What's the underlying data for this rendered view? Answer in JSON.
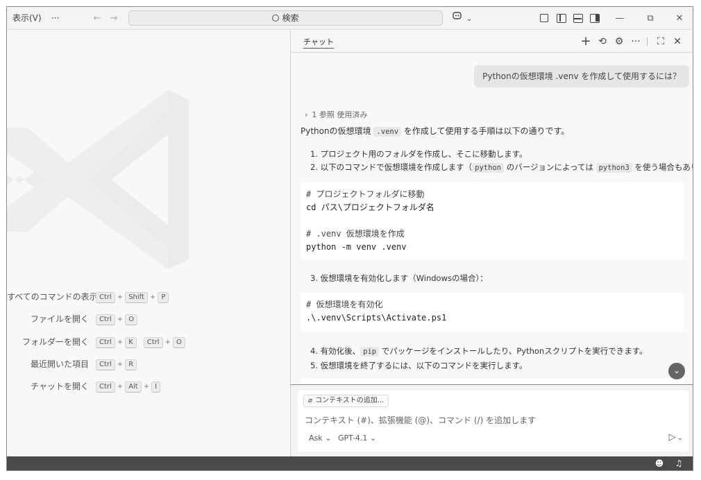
{
  "titlebar": {
    "menu_view": "表示(V)",
    "more": "···",
    "back": "←",
    "forward": "→",
    "search_placeholder": "検索",
    "copilot_chevron": "⌄",
    "minimize": "—",
    "maximize": "⧉",
    "close": "✕"
  },
  "shortcuts": [
    {
      "label": "すべてのコマンドの表示",
      "keys": [
        [
          "Ctrl",
          "Shift",
          "P"
        ]
      ]
    },
    {
      "label": "ファイルを開く",
      "keys": [
        [
          "Ctrl",
          "O"
        ]
      ]
    },
    {
      "label": "フォルダーを開く",
      "keys": [
        [
          "Ctrl",
          "K"
        ],
        [
          "Ctrl",
          "O"
        ]
      ]
    },
    {
      "label": "最近開いた項目",
      "keys": [
        [
          "Ctrl",
          "R"
        ]
      ]
    },
    {
      "label": "チャットを開く",
      "keys": [
        [
          "Ctrl",
          "Alt",
          "I"
        ]
      ]
    }
  ],
  "chat": {
    "tab_label": "チャット",
    "user_message": "Pythonの仮想環境 .venv を作成して使用するには？",
    "refs": "1 参照 使用済み",
    "intro": {
      "a": "Pythonの仮想環境 ",
      "code": ".venv",
      "b": " を作成して使用する手順は以下の通りです。"
    },
    "step1": "1. プロジェクト用のフォルダを作成し、そこに移動します。",
    "step2": {
      "a": "2. 以下のコマンドで仮想環境を作成します（",
      "code1": "python",
      "b": " のバージョンによっては ",
      "code2": "python3",
      "c": " を使う場合もあります）。"
    },
    "code1": [
      "# プロジェクトフォルダに移動",
      "cd パス\\プロジェクトフォルダ名",
      "",
      "# .venv 仮想環境を作成",
      "python -m venv .venv"
    ],
    "step3": "3. 仮想環境を有効化します（Windowsの場合）：",
    "code2": [
      "# 仮想環境を有効化",
      ".\\.venv\\Scripts\\Activate.ps1"
    ],
    "step4": {
      "a": "4. 有効化後、",
      "code": "pip",
      "b": " でパッケージをインストールしたり、Pythonスクリプトを実行できます。"
    },
    "step5": "5. 仮想環境を終了するには、以下のコマンドを実行します。",
    "context_button": "コンテキストの追加...",
    "input_placeholder": "コンテキスト (#)、拡張機能 (@)、コマンド (/) を追加します",
    "mode": "Ask",
    "model": "GPT-4.1"
  }
}
